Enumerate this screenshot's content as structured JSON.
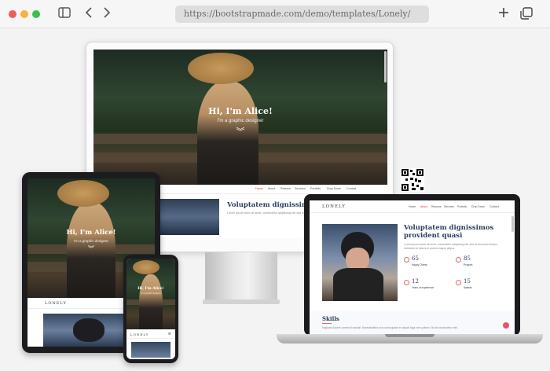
{
  "browser": {
    "url": "https://bootstrapmade.com/demo/templates/Lonely/",
    "icons": {
      "sidebar": "sidebar-icon",
      "back": "chevron-left-icon",
      "forward": "chevron-right-icon",
      "new_tab": "plus-icon",
      "tabs": "tabs-icon"
    }
  },
  "hero": {
    "title": "Hi, I'm Alice!",
    "subtitle": "I'm a graphic designer"
  },
  "site": {
    "logo": "LONELY",
    "nav": [
      "Home",
      "About",
      "Resume",
      "Services",
      "Portfolio",
      "Drop Down",
      "Contact"
    ]
  },
  "about": {
    "title_short": "Voluptatem dignissimos provi",
    "title_full": "Voluptatem dignissimos provident quasi",
    "para": "Lorem ipsum dolor sit amet, consectetur adipiscing elit, sed do eiusmod tempor incididunt ut labore et dolore magna aliqua.",
    "stats": [
      {
        "value": "65",
        "label": "Happy Clients"
      },
      {
        "value": "85",
        "label": "Projects"
      },
      {
        "value": "12",
        "label": "Years of experience"
      },
      {
        "value": "15",
        "label": "Awards"
      }
    ]
  },
  "skills": {
    "title": "Skills",
    "para": "Magnam dolores commodi suscipit. Necessitatibus eius consequatur ex aliquid fuga eum quidem. Sit sint consectetur velit."
  }
}
